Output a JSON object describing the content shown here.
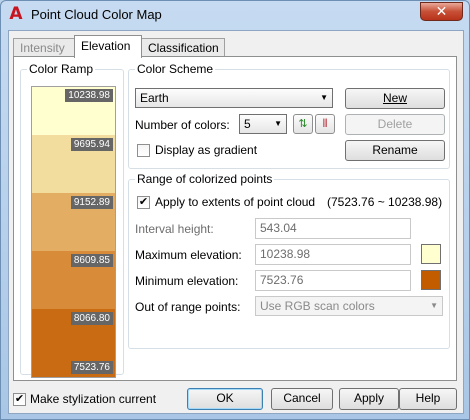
{
  "window": {
    "title": "Point Cloud Color Map",
    "close_glyph": "✕",
    "app_icon": "autocad-logo-icon"
  },
  "tabs": [
    "Intensity",
    "Elevation",
    "Classification"
  ],
  "color_ramp": {
    "title": "Color Ramp",
    "bands": [
      {
        "color": "#ffffd0",
        "label": "10238.98"
      },
      {
        "color": "#f2dc9e",
        "label": "9695.94"
      },
      {
        "color": "#e3ae64",
        "label": "9152.89"
      },
      {
        "color": "#d88b38",
        "label": "8609.85"
      },
      {
        "color": "#c96b12",
        "label": "8066.80"
      },
      {
        "color": "#c35b00",
        "label": "7523.76"
      }
    ]
  },
  "color_scheme": {
    "title": "Color Scheme",
    "scheme_value": "Earth",
    "num_colors_label": "Number of colors:",
    "num_colors_value": "5",
    "display_gradient_label": "Display as gradient",
    "display_gradient_checked": false,
    "new_button": "New",
    "delete_button": "Delete",
    "rename_button": "Rename",
    "reverse_icon": "swap-arrows-icon",
    "flip_icon": "color-bars-icon"
  },
  "range": {
    "title": "Range of colorized points",
    "apply_label": "Apply to extents of point cloud",
    "apply_checked": true,
    "extents_text": "(7523.76 ~ 10238.98)",
    "interval_label": "Interval height:",
    "interval_value": "543.04",
    "max_label": "Maximum elevation:",
    "max_value": "10238.98",
    "max_color": "#ffffd0",
    "min_label": "Minimum elevation:",
    "min_value": "7523.76",
    "min_color": "#c35b00",
    "out_label": "Out of range points:",
    "out_value": "Use RGB scan colors"
  },
  "footer": {
    "make_current_label": "Make stylization current",
    "make_current_checked": true,
    "ok_button": "OK",
    "cancel_button": "Cancel",
    "apply_button": "Apply",
    "help_button": "Help"
  }
}
